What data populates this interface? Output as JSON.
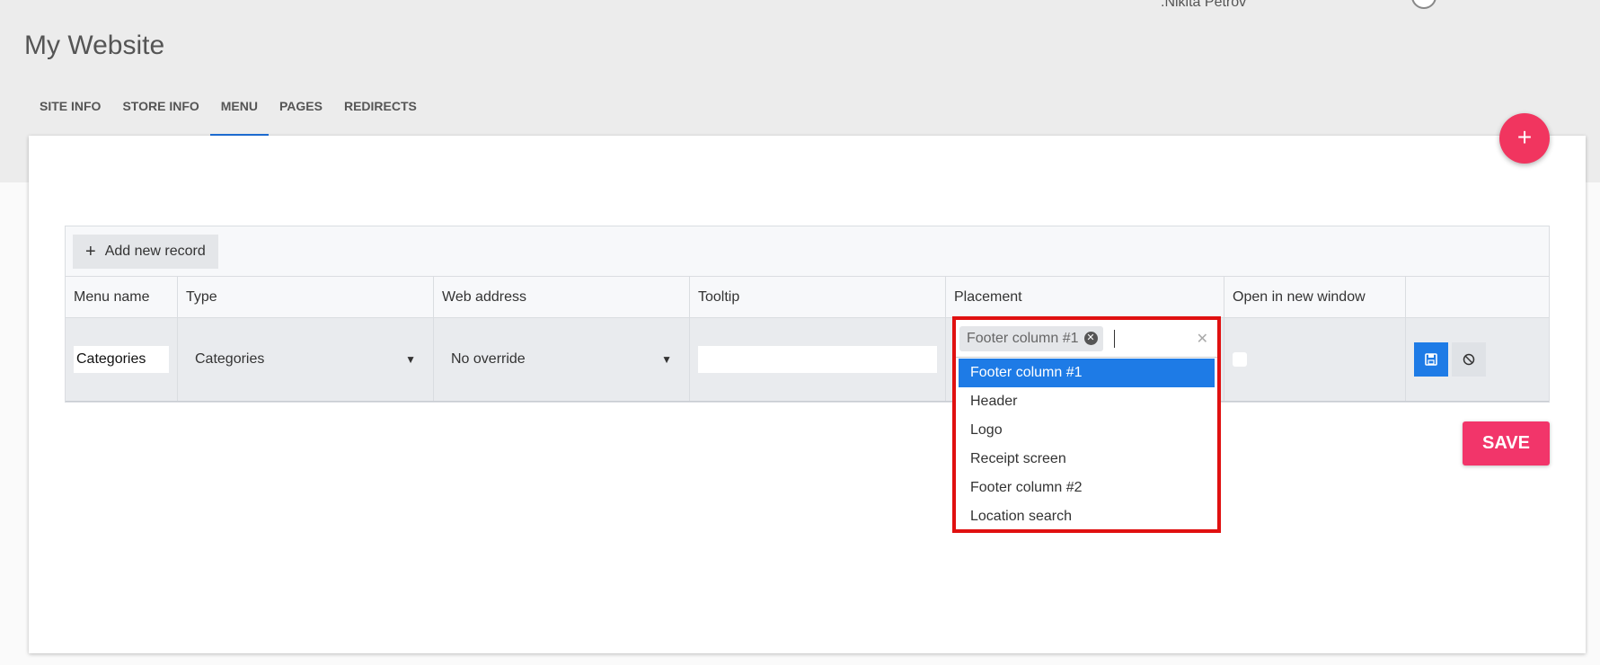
{
  "header": {
    "user_name": ".Nikita Petrov",
    "site_title": "My Website"
  },
  "tabs": [
    {
      "label": "SITE INFO"
    },
    {
      "label": "STORE INFO"
    },
    {
      "label": "MENU",
      "active": true
    },
    {
      "label": "PAGES"
    },
    {
      "label": "REDIRECTS"
    }
  ],
  "fab": {
    "label": "+"
  },
  "grid": {
    "add_button": "Add new record",
    "columns": [
      "Menu name",
      "Type",
      "Web address",
      "Tooltip",
      "Placement",
      "Open in new window",
      ""
    ],
    "row": {
      "menu_name": "Categories",
      "type": "Categories",
      "web_address": "No override",
      "tooltip": "",
      "open_in_new_window": false
    }
  },
  "placement_dropdown": {
    "selected_chip": "Footer column #1",
    "options": [
      "Footer column #1",
      "Header",
      "Logo",
      "Receipt screen",
      "Footer column #2",
      "Location search"
    ],
    "highlighted_index": 0
  },
  "save_button": {
    "label": "SAVE"
  },
  "colors": {
    "accent_pink": "#f2356a",
    "accent_blue": "#1e7be6",
    "highlight_red": "#e01010"
  },
  "icons": {
    "row_save": "floppy-disk-icon",
    "row_cancel": "ban-icon"
  }
}
